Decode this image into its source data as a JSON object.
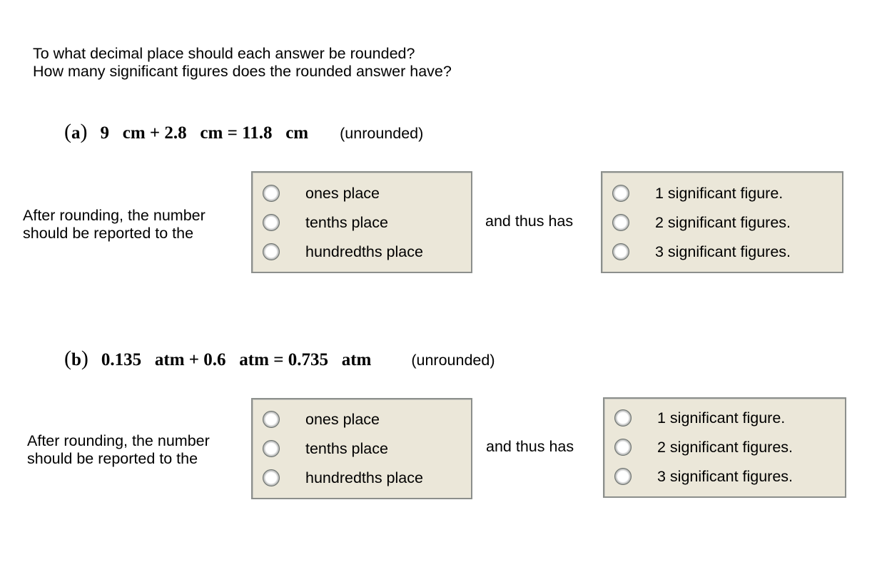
{
  "instructions": {
    "line1": "To what decimal place should each answer be rounded?",
    "line2": "How many significant figures does the rounded answer have?"
  },
  "questions": [
    {
      "label": "a",
      "equation": "9   cm + 2.8   cm = 11.8   cm",
      "status": "(unrounded)",
      "lead_line1": "After rounding, the number",
      "lead_line2": "should be reported to the",
      "place_options": [
        "ones place",
        "tenths place",
        "hundredths place"
      ],
      "connector": "and thus has",
      "sigfig_options": [
        "1 significant figure.",
        "2 significant figures.",
        "3 significant figures."
      ]
    },
    {
      "label": "b",
      "equation": "0.135   atm + 0.6   atm = 0.735   atm",
      "status": "(unrounded)",
      "lead_line1": "After rounding, the number",
      "lead_line2": "should be reported to the",
      "place_options": [
        "ones place",
        "tenths place",
        "hundredths place"
      ],
      "connector": "and thus has",
      "sigfig_options": [
        "1 significant figure.",
        "2 significant figures.",
        "3 significant figures."
      ]
    }
  ],
  "colors": {
    "box_background": "#ebe7d9",
    "box_border": "#8c8f8c"
  }
}
